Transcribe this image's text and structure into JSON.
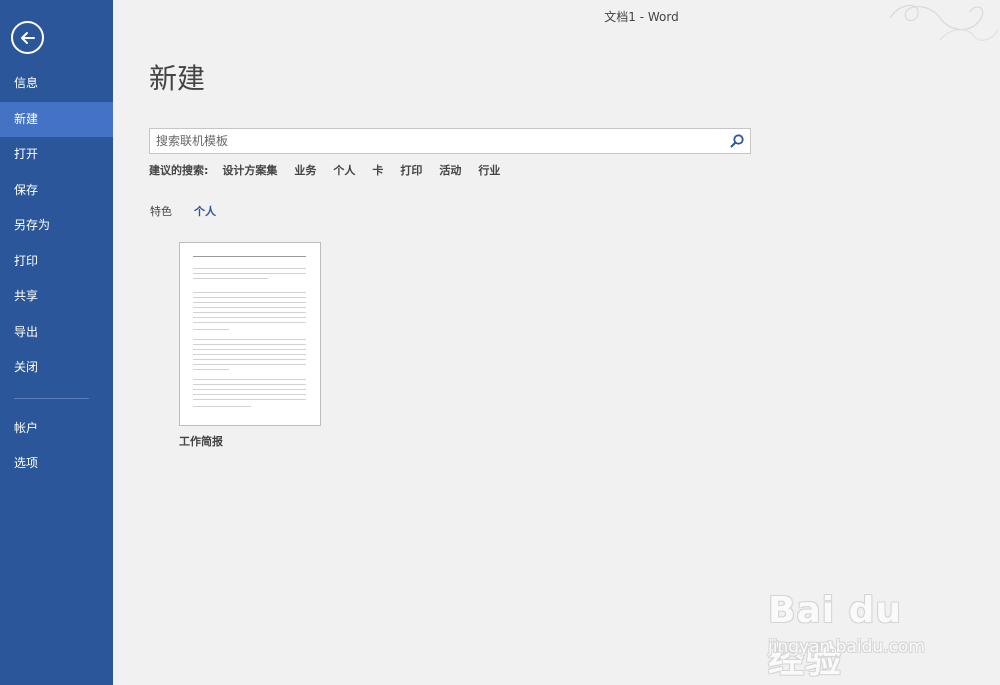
{
  "window": {
    "title": "文档1 - Word"
  },
  "sidebar": {
    "items": [
      {
        "label": "信息"
      },
      {
        "label": "新建"
      },
      {
        "label": "打开"
      },
      {
        "label": "保存"
      },
      {
        "label": "另存为"
      },
      {
        "label": "打印"
      },
      {
        "label": "共享"
      },
      {
        "label": "导出"
      },
      {
        "label": "关闭"
      }
    ],
    "bottom_items": [
      {
        "label": "帐户"
      },
      {
        "label": "选项"
      }
    ],
    "active": "新建"
  },
  "main": {
    "heading": "新建",
    "search": {
      "placeholder": "搜索联机模板",
      "value": ""
    },
    "suggested": {
      "label": "建议的搜索:",
      "links": [
        "设计方案集",
        "业务",
        "个人",
        "卡",
        "打印",
        "活动",
        "行业"
      ]
    },
    "tabs": [
      {
        "label": "特色"
      },
      {
        "label": "个人"
      }
    ],
    "active_tab": "个人",
    "templates": [
      {
        "name": "工作简报"
      }
    ]
  },
  "watermark": {
    "main": "Bai du 经验",
    "sub": "jingyan.baidu.com"
  },
  "colors": {
    "sidebar": "#2b579a",
    "sidebar_active": "#4472c4",
    "background": "#f1f1f1",
    "accent": "#2b579a"
  },
  "icons": {
    "back": "back-arrow-icon",
    "search": "search-icon"
  }
}
